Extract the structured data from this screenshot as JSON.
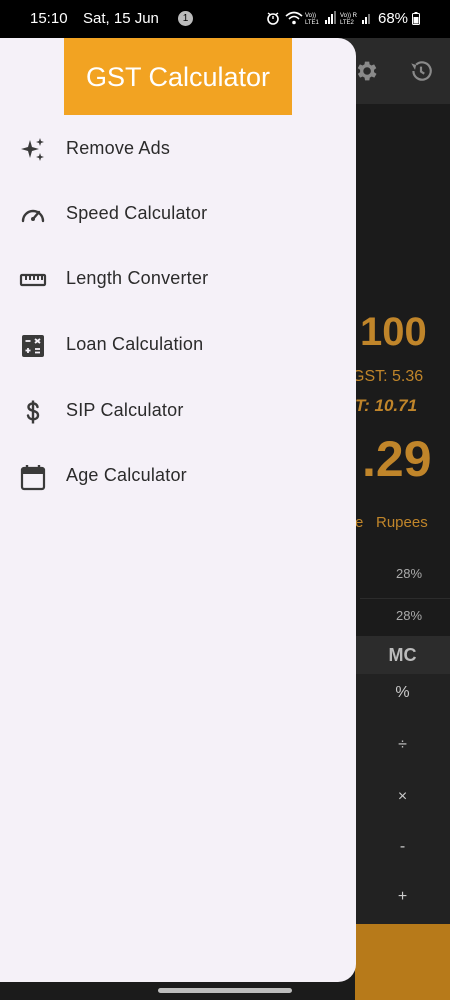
{
  "status_bar": {
    "time": "15:10",
    "date": "Sat, 15 Jun",
    "notification_count": "1",
    "battery": "68%"
  },
  "drawer": {
    "title": "GST Calculator",
    "items": [
      {
        "label": "Remove Ads",
        "icon": "sparkle-icon"
      },
      {
        "label": "Speed Calculator",
        "icon": "speedometer-icon"
      },
      {
        "label": "Length Converter",
        "icon": "ruler-icon"
      },
      {
        "label": "Loan Calculation",
        "icon": "calculator-icon"
      },
      {
        "label": "SIP Calculator",
        "icon": "dollar-icon"
      },
      {
        "label": "Age Calculator",
        "icon": "calendar-icon"
      }
    ]
  },
  "background": {
    "amount": "100",
    "gst_line": "GST: 5.36",
    "total_gst_line": "T: 10.71",
    "result": ".29",
    "unit_label": "e",
    "currency": "Rupees",
    "rate_1": "28%",
    "rate_2": "28%",
    "keys": [
      "MC",
      "%",
      "÷",
      "×",
      "-",
      "+"
    ]
  },
  "colors": {
    "drawer_bg": "#f5f1f8",
    "title_bg": "#f2a322",
    "accent_text": "#c0852a"
  }
}
